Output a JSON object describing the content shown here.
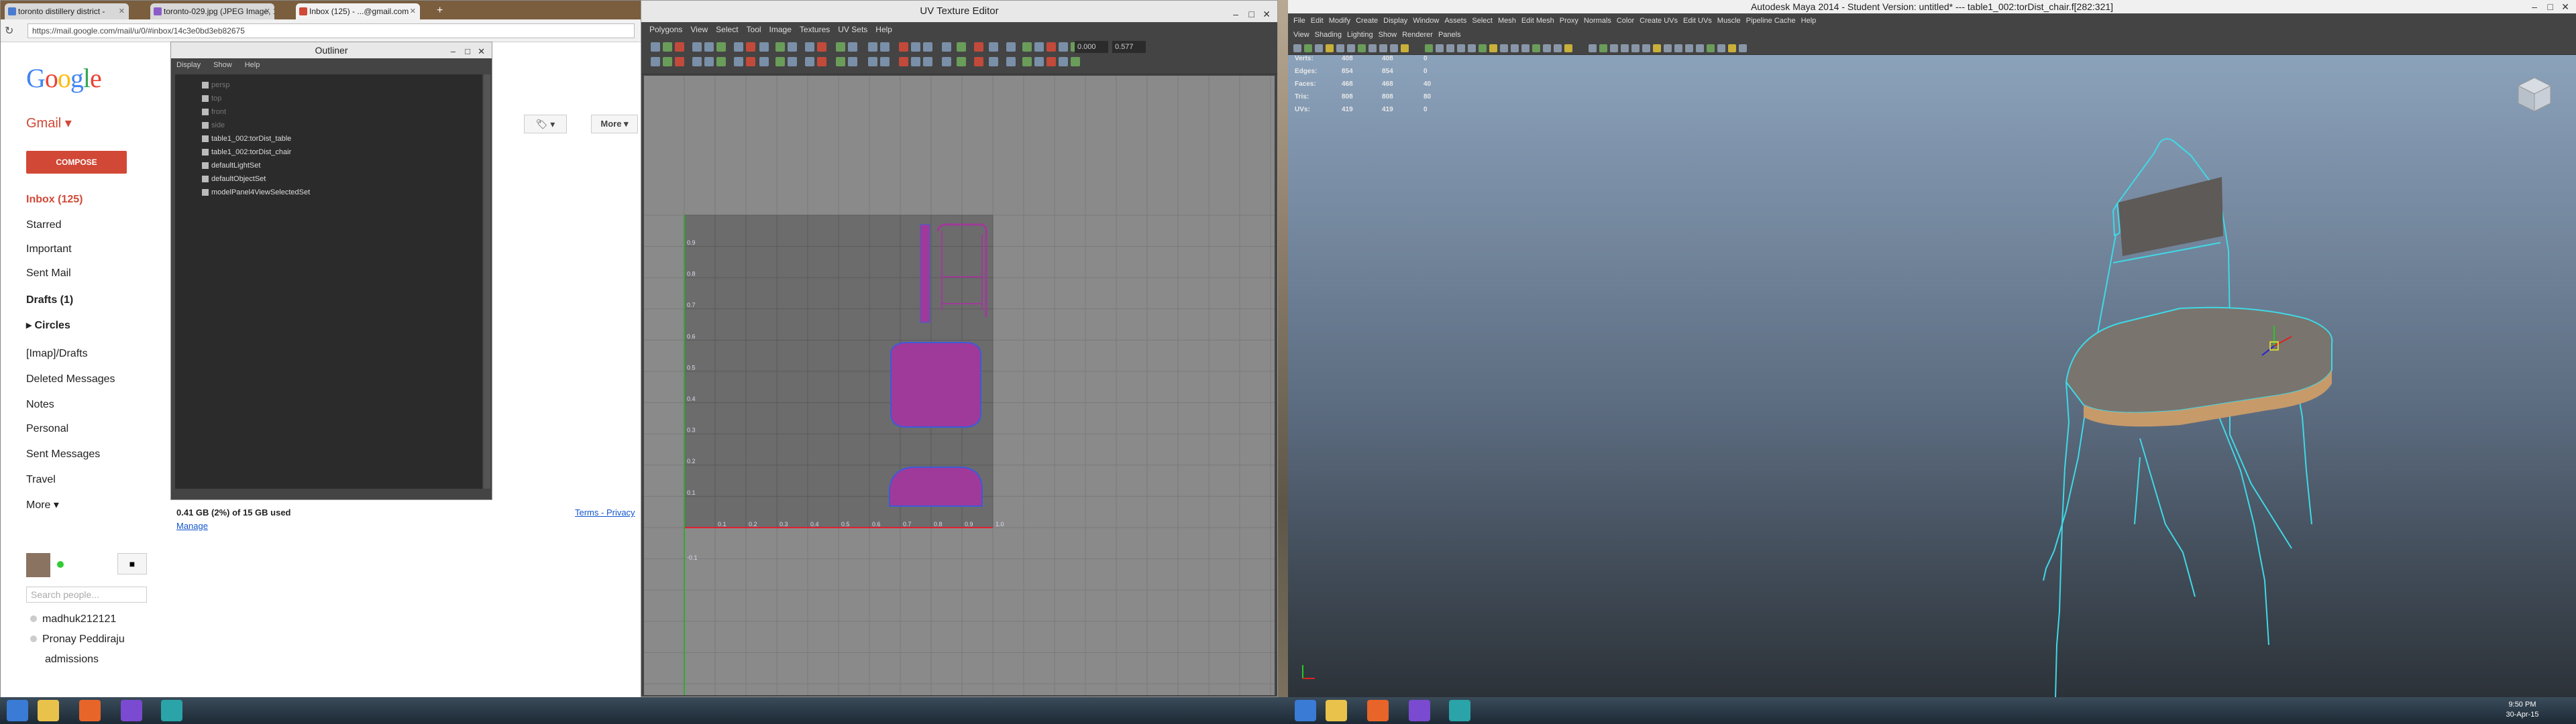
{
  "browser": {
    "tabs": [
      {
        "label": "toronto distillery district - "
      },
      {
        "label": "toronto-029.jpg (JPEG Image, 1"
      },
      {
        "label": "Inbox (125) - ...@gmail.com"
      }
    ],
    "url": "https://mail.google.com/mail/u/0/#inbox/14c3e0bd3eb82675"
  },
  "gmail": {
    "logo": "Google",
    "app_label": "Gmail ▾",
    "compose": "COMPOSE",
    "folders": [
      {
        "label": "Inbox (125)"
      },
      {
        "label": "Starred"
      },
      {
        "label": "Important"
      },
      {
        "label": "Sent Mail"
      },
      {
        "label": "Drafts (1)"
      },
      {
        "label": "▸ Circles"
      },
      {
        "label": "[Imap]/Drafts"
      },
      {
        "label": "Deleted Messages"
      },
      {
        "label": "Notes"
      },
      {
        "label": "Personal"
      },
      {
        "label": "Sent Messages"
      },
      {
        "label": "Travel"
      },
      {
        "label": "More ▾"
      }
    ],
    "more_button": "More ▾",
    "label_button": "🏷 ▾",
    "storage": "0.41 GB (2%) of 15 GB used",
    "manage": "Manage",
    "terms": "Terms - Privacy",
    "search_people_placeholder": "Search people...",
    "contacts": [
      {
        "name": "madhuk212121"
      },
      {
        "name": "Pronay Peddiraju"
      },
      {
        "name": "admissions"
      }
    ]
  },
  "outliner": {
    "title": "Outliner",
    "menu": [
      "Display",
      "Show",
      "Help"
    ],
    "rows": [
      {
        "label": "persp",
        "dim": true
      },
      {
        "label": "top",
        "dim": true
      },
      {
        "label": "front",
        "dim": true
      },
      {
        "label": "side",
        "dim": true
      },
      {
        "label": "table1_002:torDist_table",
        "dim": false
      },
      {
        "label": "table1_002:torDist_chair",
        "dim": false
      },
      {
        "label": "defaultLightSet",
        "dim": false
      },
      {
        "label": "defaultObjectSet",
        "dim": false
      },
      {
        "label": "modelPanel4ViewSelectedSet",
        "dim": false
      }
    ]
  },
  "uv_editor": {
    "title": "UV Texture Editor",
    "menu": [
      "Polygons",
      "View",
      "Select",
      "Tool",
      "Image",
      "Textures",
      "UV Sets",
      "Help"
    ],
    "field1": "0.000",
    "field2": "0.577",
    "axis_labels": [
      "0.9",
      "0.8",
      "0.7",
      "0.6",
      "0.5",
      "0.4",
      "0.3",
      "0.2",
      "0.1",
      "-0.1",
      "0.1",
      "0.2",
      "0.3",
      "0.4",
      "0.5",
      "0.6",
      "0.7",
      "0.8",
      "0.9",
      "1.0"
    ],
    "colors": {
      "uv_shell_fill": "#a03a9a",
      "uv_edge": "#3b5bdb",
      "grid": "#5a5a5a"
    }
  },
  "maya": {
    "title": "Autodesk Maya 2014 - Student Version: untitled*  ---  table1_002:torDist_chair.f[282:321]",
    "menu": [
      "File",
      "Edit",
      "Modify",
      "Create",
      "Display",
      "Window",
      "Assets",
      "Select",
      "Mesh",
      "Edit Mesh",
      "Proxy",
      "Normals",
      "Color",
      "Create UVs",
      "Edit UVs",
      "Muscle",
      "Pipeline Cache",
      "Help"
    ],
    "panel_menu": [
      "View",
      "Shading",
      "Lighting",
      "Show",
      "Renderer",
      "Panels"
    ],
    "hud": {
      "headers": [
        "",
        "",
        ""
      ],
      "rows": [
        {
          "label": "Verts:",
          "a": "408",
          "b": "408",
          "c": "0"
        },
        {
          "label": "Edges:",
          "a": "854",
          "b": "854",
          "c": "0"
        },
        {
          "label": "Faces:",
          "a": "468",
          "b": "468",
          "c": "40"
        },
        {
          "label": "Tris:",
          "a": "808",
          "b": "808",
          "c": "80"
        },
        {
          "label": "UVs:",
          "a": "419",
          "b": "419",
          "c": "0"
        }
      ]
    },
    "colors": {
      "wireframe": "#3fd9e6",
      "seat_fill": "#7a746e",
      "back_fill": "#5e5a58"
    }
  },
  "taskbar": {
    "left_time": "",
    "right_time": "9:50 PM",
    "right_date": "30-Apr-15"
  }
}
